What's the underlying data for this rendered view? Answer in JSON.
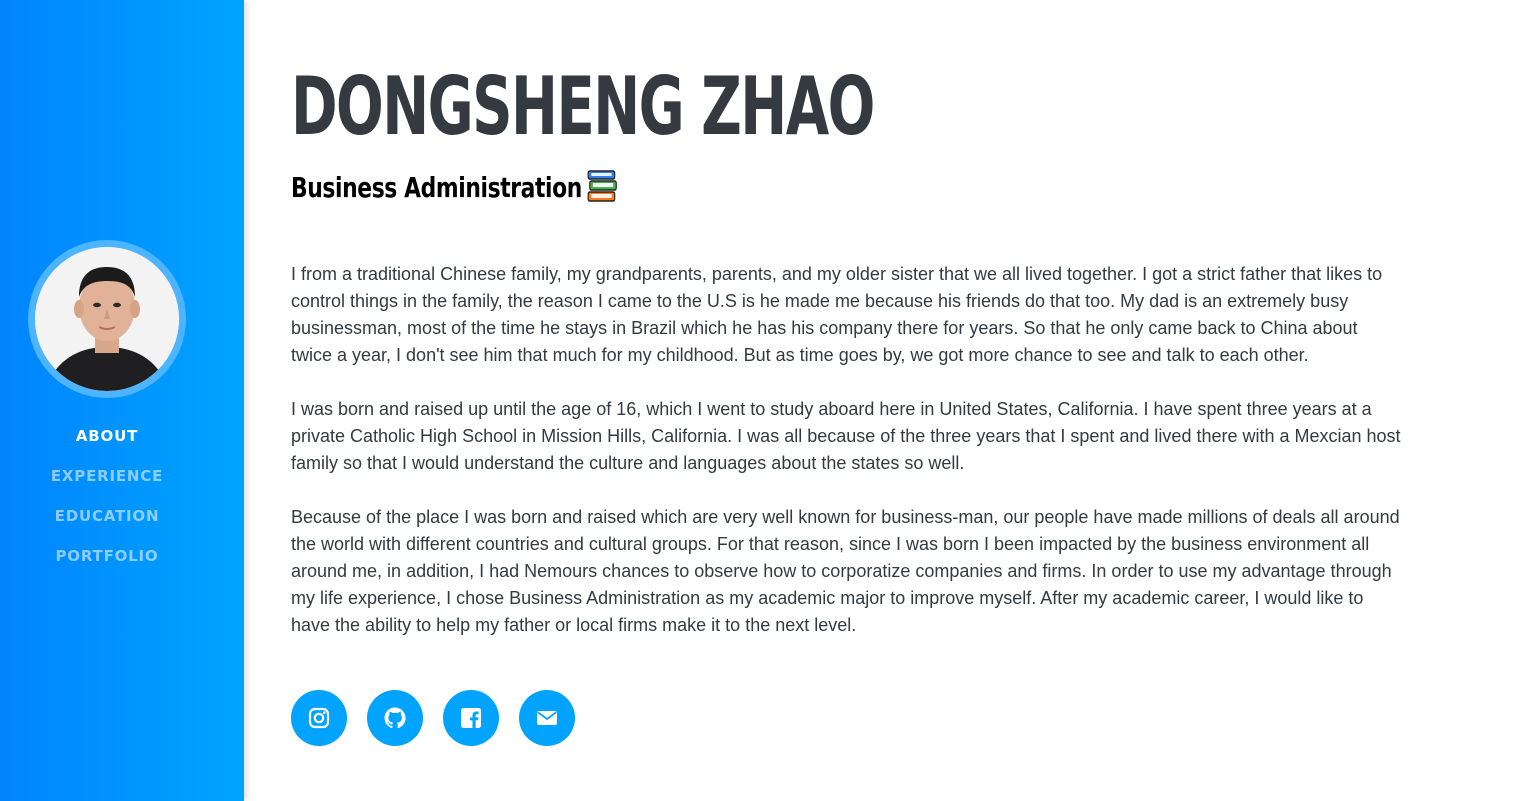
{
  "profile": {
    "name": "DONGSHENG ZHAO",
    "subtitle": "Business Administration"
  },
  "nav": {
    "items": [
      {
        "label": "ABOUT",
        "active": true
      },
      {
        "label": "EXPERIENCE",
        "active": false
      },
      {
        "label": "EDUCATION",
        "active": false
      },
      {
        "label": "PORTFOLIO",
        "active": false
      }
    ]
  },
  "bio": {
    "paragraphs": [
      "I from a traditional Chinese family, my grandparents, parents, and my older sister that we all lived together. I got a strict father that likes to control things in the family, the reason I came to the U.S is he made me because his friends do that too. My dad is an extremely busy businessman, most of the time he stays in Brazil which he has his company there for years. So that he only came back to China about twice a year, I don't see him that much for my childhood. But as time goes by, we got more chance to see and talk to each other.",
      "I was born and raised up until the age of 16, which I went to study aboard here in United States, California. I have spent three years at a private Catholic High School in Mission Hills, California. I was all because of the three years that I spent and lived there with a Mexcian host family so that I would understand the culture and languages about the states so well.",
      "Because of the place I was born and raised which are very well known for business-man, our people have made millions of deals all around the world with different countries and cultural groups. For that reason, since I was born I been impacted by the business environment all around me, in addition, I had Nemours chances to observe how to corporatize companies and firms. In order to use my advantage through my life experience, I chose Business Administration as my academic major to improve myself. After my academic career, I would like to have the ability to help my father or local firms make it to the next level."
    ]
  },
  "social": {
    "icons": [
      "instagram-icon",
      "github-icon",
      "facebook-icon",
      "email-icon"
    ]
  },
  "colors": {
    "sidebar_start": "#0084ff",
    "sidebar_end": "#00a4ff",
    "accent": "#00a4ff",
    "heading": "#343a40"
  }
}
